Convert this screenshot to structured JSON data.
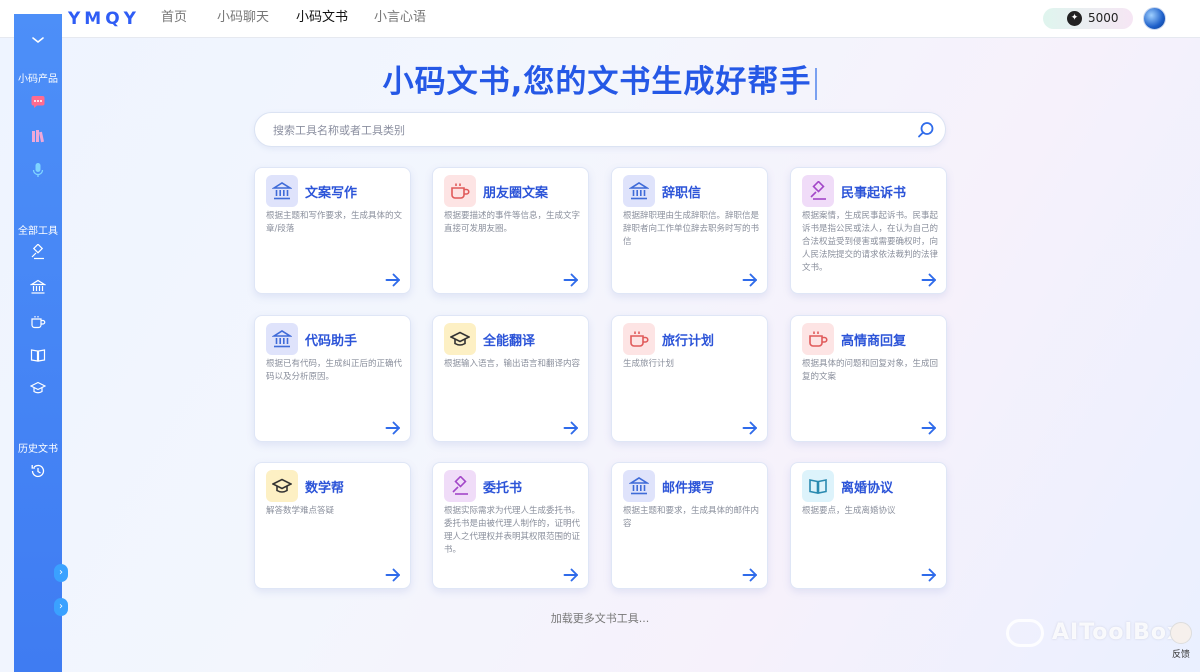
{
  "app": {
    "logo_text": "YMQY"
  },
  "nav": {
    "items": [
      {
        "label": "首页",
        "active": false
      },
      {
        "label": "小码聊天",
        "active": false
      },
      {
        "label": "小码文书",
        "active": true
      },
      {
        "label": "小言心语",
        "active": false
      }
    ]
  },
  "account": {
    "credits": "5000",
    "credit_icon": "lightbulb-icon"
  },
  "sidebar": {
    "products_label": "小码产品",
    "all_tools_label": "全部工具",
    "history_label": "历史文书",
    "product_icons": [
      "chat-icon",
      "books-icon",
      "microphone-icon"
    ],
    "tool_icons": [
      "gavel-icon",
      "bank-icon",
      "cup-icon",
      "book-icon",
      "mortarboard-icon"
    ],
    "history_icon": "history-icon",
    "collapse_tabs": [
      "›",
      "›"
    ]
  },
  "hero": {
    "headline": "小码文书,您的文书生成好帮手"
  },
  "search": {
    "placeholder": "搜索工具名称或者工具类别"
  },
  "cards": [
    {
      "title": "文案写作",
      "desc": "根据主题和写作要求，生成具体的文章/段落",
      "icon": "bank-icon",
      "icon_bg": "#dfe3fb",
      "icon_color": "#3f6bd8"
    },
    {
      "title": "朋友圈文案",
      "desc": "根据要描述的事件等信息，生成文字直接可发朋友圈。",
      "icon": "cup-icon",
      "icon_bg": "#fde4e4",
      "icon_color": "#e05a5a"
    },
    {
      "title": "辞职信",
      "desc": "根据辞职理由生成辞职信。辞职信是辞职者向工作单位辞去职务时写的书信",
      "icon": "bank-icon",
      "icon_bg": "#dfe3fb",
      "icon_color": "#3f6bd8"
    },
    {
      "title": "民事起诉书",
      "desc": "根据案情，生成民事起诉书。民事起诉书是指公民或法人，在认为自己的合法权益受到侵害或需要确权时，向人民法院提交的请求依法裁判的法律文书。",
      "icon": "gavel-icon",
      "icon_bg": "#f0dcf8",
      "icon_color": "#a347c8"
    },
    {
      "title": "代码助手",
      "desc": "根据已有代码，生成纠正后的正确代码以及分析原因。",
      "icon": "bank-icon",
      "icon_bg": "#dfe3fb",
      "icon_color": "#3f6bd8"
    },
    {
      "title": "全能翻译",
      "desc": "根据输入语言，输出语言和翻译内容",
      "icon": "mortarboard-icon",
      "icon_bg": "#fdf0c4",
      "icon_color": "#333333"
    },
    {
      "title": "旅行计划",
      "desc": "生成旅行计划",
      "icon": "cup-icon",
      "icon_bg": "#fde4e4",
      "icon_color": "#e05a5a"
    },
    {
      "title": "高情商回复",
      "desc": "根据具体的问题和回复对象，生成回复的文案",
      "icon": "cup-icon",
      "icon_bg": "#fde4e4",
      "icon_color": "#e05a5a"
    },
    {
      "title": "数学帮",
      "desc": "解答数学难点答疑",
      "icon": "mortarboard-icon",
      "icon_bg": "#fdf0c4",
      "icon_color": "#333333"
    },
    {
      "title": "委托书",
      "desc": "根据实际需求为代理人生成委托书。委托书是由被代理人制作的，证明代理人之代理权并表明其权限范围的证书。",
      "icon": "gavel-icon",
      "icon_bg": "#f0dcf8",
      "icon_color": "#a347c8"
    },
    {
      "title": "邮件撰写",
      "desc": "根据主题和要求，生成具体的邮件内容",
      "icon": "bank-icon",
      "icon_bg": "#dfe3fb",
      "icon_color": "#3f6bd8"
    },
    {
      "title": "离婚协议",
      "desc": "根据要点，生成离婚协议",
      "icon": "book-icon",
      "icon_bg": "#ddf3fb",
      "icon_color": "#2a8ab0"
    }
  ],
  "load_more": "加载更多文书工具...",
  "watermark": "AIToolBox",
  "feedback": {
    "label": "反馈"
  },
  "colors": {
    "accent": "#2558e6",
    "sidebar": "#4387f5",
    "arrow": "#2f6bea"
  }
}
